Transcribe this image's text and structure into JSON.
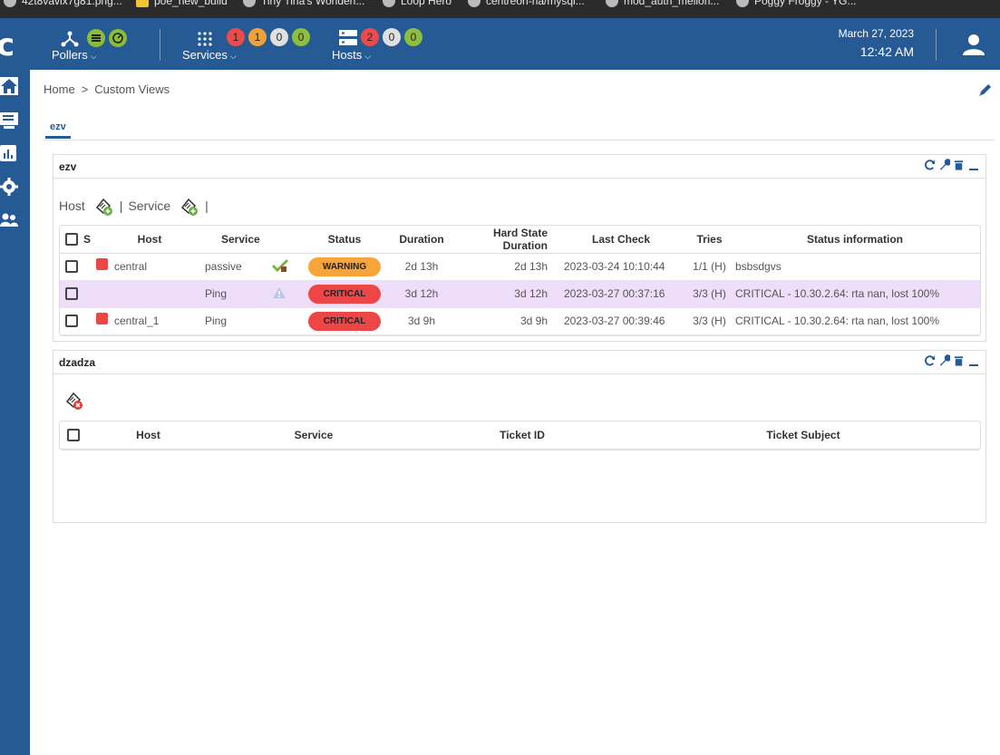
{
  "bookmarks": [
    {
      "label": "42t8vavix7g81.png..."
    },
    {
      "label": "poe_new_build"
    },
    {
      "label": "Tiny Tina's Wonderl..."
    },
    {
      "label": "Loop Hero"
    },
    {
      "label": "centreon-ha/mysql..."
    },
    {
      "label": "mod_auth_mellon..."
    },
    {
      "label": "Poggy Froggy - YG..."
    }
  ],
  "header": {
    "logo": "c",
    "pollers": {
      "label": "Pollers",
      "icon": "poller-icon"
    },
    "services": {
      "label": "Services",
      "counts": [
        "1",
        "1",
        "0",
        "0"
      ]
    },
    "hosts": {
      "label": "Hosts",
      "counts": [
        "2",
        "0",
        "0"
      ]
    },
    "date": "March 27, 2023",
    "time": "12:42 AM"
  },
  "breadcrumb": {
    "home": "Home",
    "separator": ">",
    "current": "Custom Views"
  },
  "tabs": [
    {
      "label": "ezv"
    }
  ],
  "widgets": {
    "ezv": {
      "title": "ezv",
      "actions": {
        "host_label": "Host",
        "service_label": "Service",
        "pipe": "|"
      },
      "columns": [
        "S",
        "Host",
        "Service",
        "Status",
        "Duration",
        "Hard State Duration",
        "Last Check",
        "Tries",
        "Status information"
      ],
      "rows": [
        {
          "host": "central",
          "service": "passive",
          "status": "WARNING",
          "duration": "2d 13h",
          "hard_duration": "2d 13h",
          "last_check": "2023-03-24 10:10:44",
          "tries": "1/1 (H)",
          "info": "bsbsdgvs"
        },
        {
          "host": "",
          "service": "Ping",
          "status": "CRITICAL",
          "duration": "3d 12h",
          "hard_duration": "3d 12h",
          "last_check": "2023-03-27 00:37:16",
          "tries": "3/3 (H)",
          "info": "CRITICAL - 10.30.2.64: rta nan, lost 100%"
        },
        {
          "host": "central_1",
          "service": "Ping",
          "status": "CRITICAL",
          "duration": "3d 9h",
          "hard_duration": "3d 9h",
          "last_check": "2023-03-27 00:39:46",
          "tries": "3/3 (H)",
          "info": "CRITICAL - 10.30.2.64: rta nan, lost 100%"
        }
      ]
    },
    "dzadza": {
      "title": "dzadza",
      "columns": [
        "Host",
        "Service",
        "Ticket ID",
        "Ticket Subject"
      ]
    }
  },
  "colors": {
    "brand": "#265a94",
    "critical": "#ee4646",
    "warning": "#f7a43a",
    "ok": "#8fbd3e",
    "highlight_row": "#efdefa"
  }
}
